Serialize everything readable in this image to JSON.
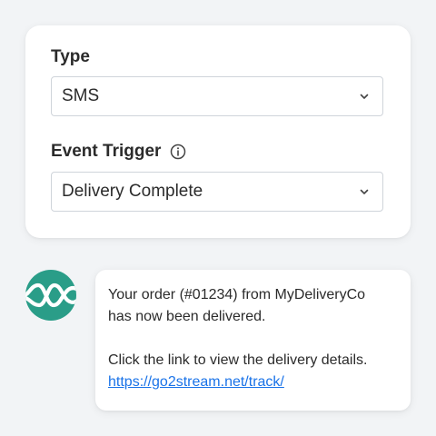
{
  "form": {
    "type_label": "Type",
    "type_value": "SMS",
    "trigger_label": "Event Trigger",
    "trigger_value": "Delivery Complete",
    "icons": {
      "info": "info-icon",
      "dropdown": "chevron-down-icon"
    }
  },
  "message": {
    "avatar_icon": "wave-logo-icon",
    "line1": "Your order (#01234) from MyDeliveryCo",
    "line2": "has now been delivered.",
    "line3": "Click the link to view the delivery details.",
    "link": "https://go2stream.net/track/"
  },
  "colors": {
    "accent": "#2a9d88",
    "link": "#1a73e8",
    "background": "#f2f4f6"
  }
}
